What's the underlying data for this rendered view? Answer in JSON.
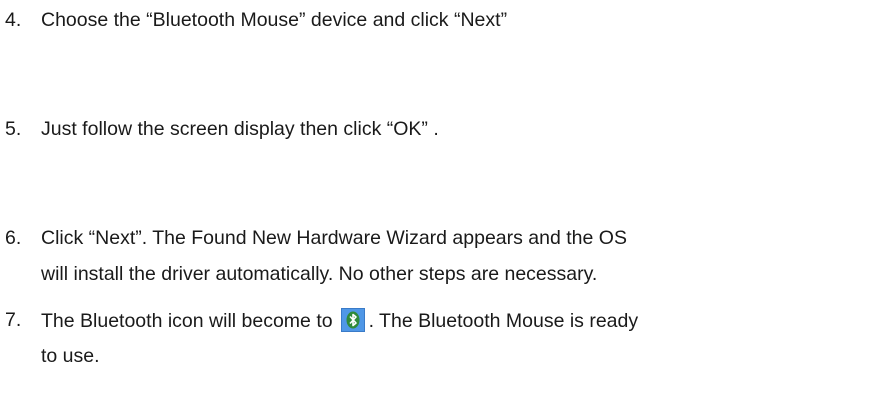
{
  "steps": [
    {
      "number": "4.",
      "lines": [
        "Choose the “Bluetooth Mouse” device and click “Next”"
      ]
    },
    {
      "number": "5.",
      "lines": [
        "Just follow the screen display then click “OK” ."
      ]
    },
    {
      "number": "6.",
      "lines": [
        "Click “Next”. The Found New Hardware Wizard appears and the OS",
        "will install the driver automatically. No other steps are necessary."
      ]
    },
    {
      "number": "7.",
      "line1_before_icon": "The Bluetooth icon will become to",
      "line1_after_icon": ". The Bluetooth Mouse is ready",
      "line2": "to use.",
      "icon": "bluetooth-tray-icon",
      "icon_colors": {
        "background": "#4f97e6",
        "badge": "#2f8a3a",
        "glyph": "#ffffff"
      }
    }
  ]
}
